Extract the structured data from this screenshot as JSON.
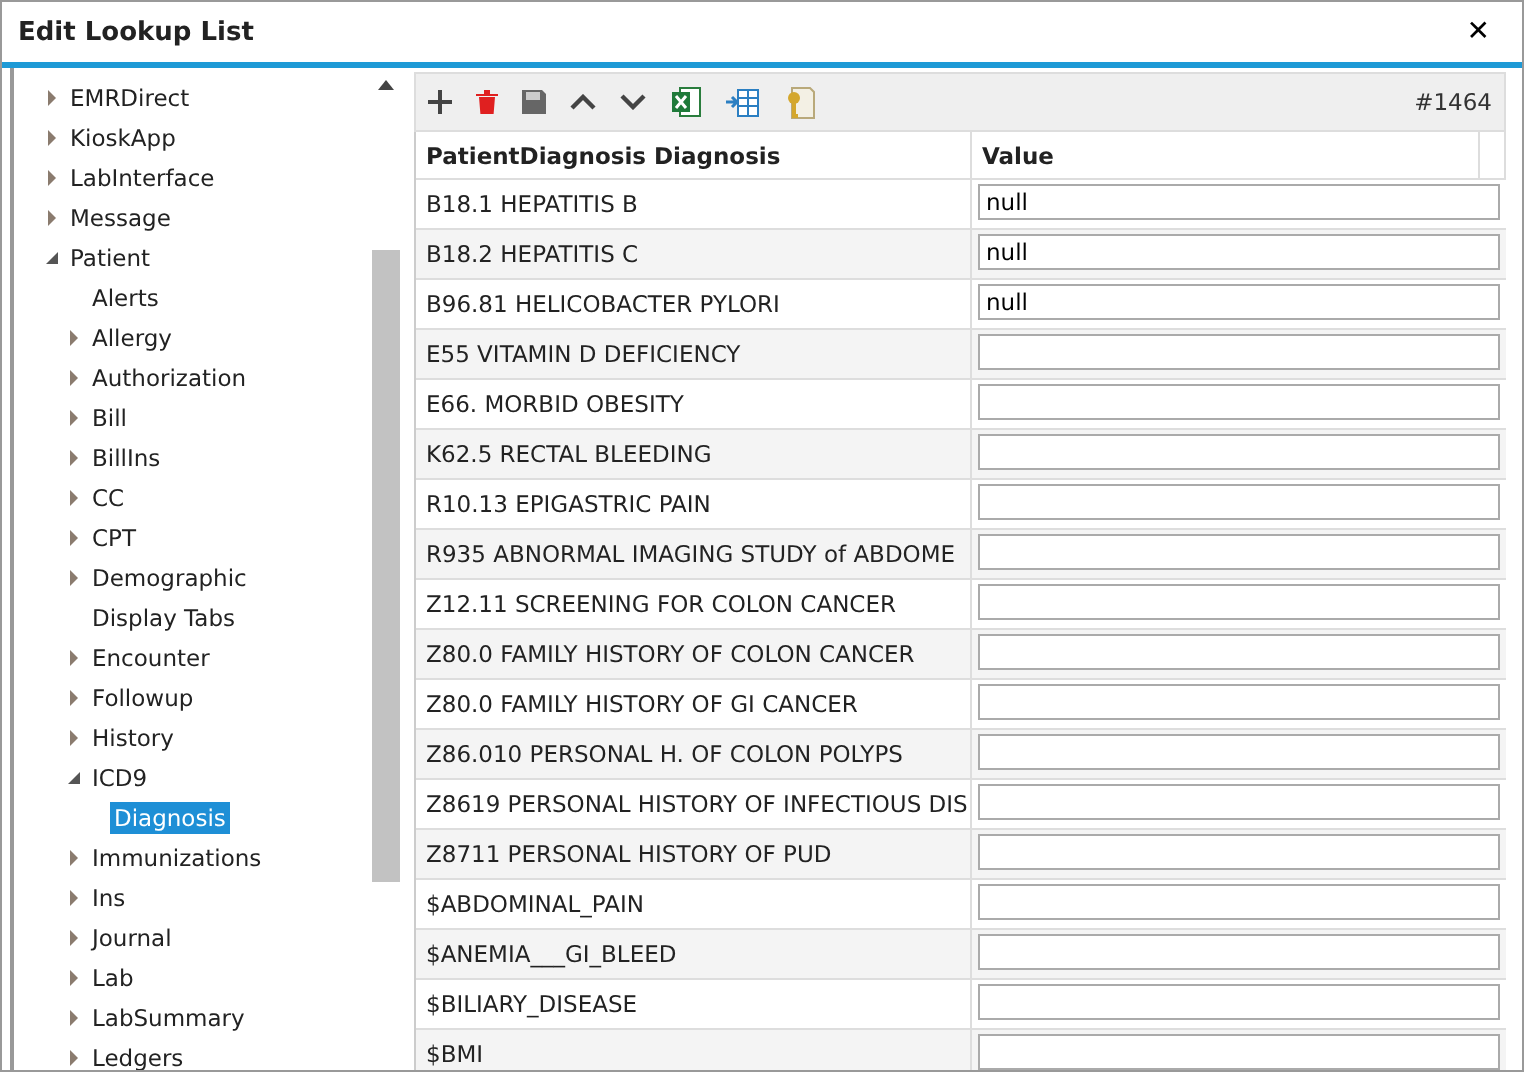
{
  "window": {
    "title": "Edit Lookup List",
    "close": "✕"
  },
  "tree": [
    {
      "label": "EMRDirect",
      "kind": "folder",
      "expanded": false,
      "selected": false
    },
    {
      "label": "KioskApp",
      "kind": "folder",
      "expanded": false,
      "selected": false
    },
    {
      "label": "LabInterface",
      "kind": "folder",
      "expanded": false,
      "selected": false
    },
    {
      "label": "Message",
      "kind": "folder",
      "expanded": false,
      "selected": false
    },
    {
      "label": "Patient",
      "kind": "folder",
      "expanded": true,
      "selected": false,
      "children": [
        {
          "label": "Alerts",
          "kind": "leaf",
          "selected": false
        },
        {
          "label": "Allergy",
          "kind": "folder",
          "expanded": false,
          "selected": false
        },
        {
          "label": "Authorization",
          "kind": "folder",
          "expanded": false,
          "selected": false
        },
        {
          "label": "Bill",
          "kind": "folder",
          "expanded": false,
          "selected": false
        },
        {
          "label": "BillIns",
          "kind": "folder",
          "expanded": false,
          "selected": false
        },
        {
          "label": "CC",
          "kind": "folder",
          "expanded": false,
          "selected": false
        },
        {
          "label": "CPT",
          "kind": "folder",
          "expanded": false,
          "selected": false
        },
        {
          "label": "Demographic",
          "kind": "folder",
          "expanded": false,
          "selected": false
        },
        {
          "label": "Display Tabs",
          "kind": "leaf",
          "selected": false
        },
        {
          "label": "Encounter",
          "kind": "folder",
          "expanded": false,
          "selected": false
        },
        {
          "label": "Followup",
          "kind": "folder",
          "expanded": false,
          "selected": false
        },
        {
          "label": "History",
          "kind": "folder",
          "expanded": false,
          "selected": false
        },
        {
          "label": "ICD9",
          "kind": "folder",
          "expanded": true,
          "selected": false,
          "children": [
            {
              "label": "Diagnosis",
              "kind": "leaf",
              "selected": true
            }
          ]
        },
        {
          "label": "Immunizations",
          "kind": "folder",
          "expanded": false,
          "selected": false
        },
        {
          "label": "Ins",
          "kind": "folder",
          "expanded": false,
          "selected": false
        },
        {
          "label": "Journal",
          "kind": "folder",
          "expanded": false,
          "selected": false
        },
        {
          "label": "Lab",
          "kind": "folder",
          "expanded": false,
          "selected": false
        },
        {
          "label": "LabSummary",
          "kind": "folder",
          "expanded": false,
          "selected": false
        },
        {
          "label": "Ledgers",
          "kind": "folder",
          "expanded": false,
          "selected": false
        }
      ]
    }
  ],
  "toolbar": {
    "record_count": "#1464"
  },
  "table": {
    "columns": [
      "PatientDiagnosis Diagnosis",
      "Value"
    ],
    "rows": [
      {
        "diagnosis": "B18.1 HEPATITIS B",
        "value": "null"
      },
      {
        "diagnosis": "B18.2 HEPATITIS C",
        "value": "null"
      },
      {
        "diagnosis": "B96.81 HELICOBACTER PYLORI",
        "value": "null"
      },
      {
        "diagnosis": "E55 VITAMIN D DEFICIENCY"
      },
      {
        "diagnosis": "E66. MORBID OBESITY"
      },
      {
        "diagnosis": "K62.5 RECTAL BLEEDING"
      },
      {
        "diagnosis": "R10.13 EPIGASTRIC PAIN"
      },
      {
        "diagnosis": "R935 ABNORMAL IMAGING STUDY of ABDOME"
      },
      {
        "diagnosis": "Z12.11 SCREENING FOR COLON CANCER"
      },
      {
        "diagnosis": "Z80.0 FAMILY HISTORY OF COLON CANCER"
      },
      {
        "diagnosis": "Z80.0 FAMILY HISTORY OF GI CANCER"
      },
      {
        "diagnosis": "Z86.010 PERSONAL H. OF COLON POLYPS"
      },
      {
        "diagnosis": "Z8619 PERSONAL HISTORY OF INFECTIOUS DIS"
      },
      {
        "diagnosis": "Z8711 PERSONAL HISTORY OF PUD"
      },
      {
        "diagnosis": "$ABDOMINAL_PAIN"
      },
      {
        "diagnosis": "$ANEMIA___GI_BLEED"
      },
      {
        "diagnosis": "$BILIARY_DISEASE"
      },
      {
        "diagnosis": "$BMI"
      }
    ]
  }
}
